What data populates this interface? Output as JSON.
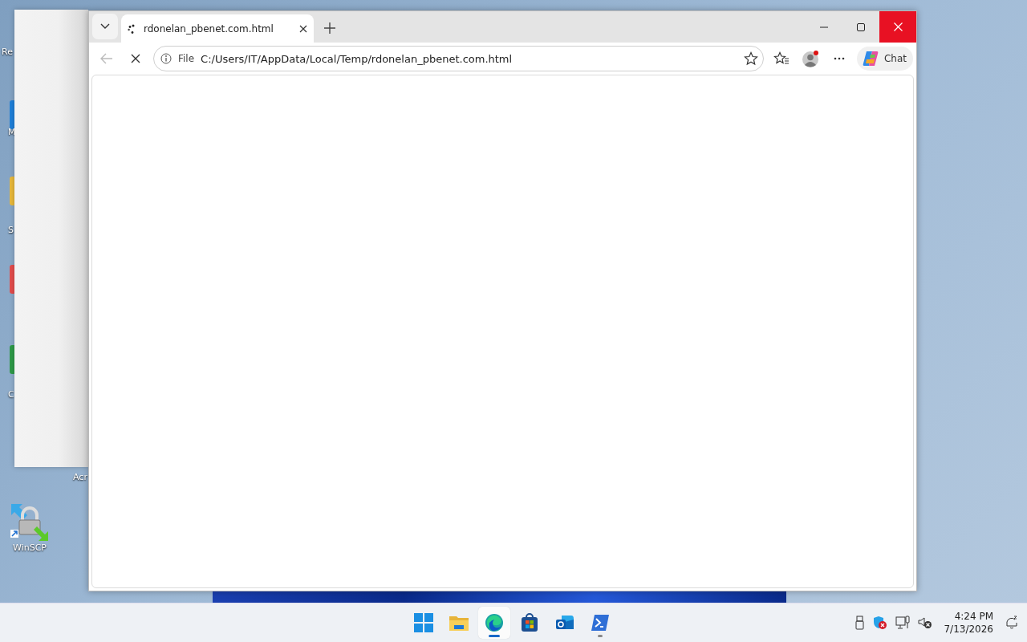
{
  "desktop": {
    "icons": [
      {
        "kind": "label",
        "label": "Re"
      },
      {
        "kind": "blue",
        "label": "M"
      },
      {
        "kind": "yellow",
        "label": "S"
      },
      {
        "kind": "red"
      },
      {
        "kind": "green",
        "label": "C"
      },
      {
        "kind": "label",
        "label": "Acr"
      },
      {
        "kind": "winscp",
        "label": "WinSCP"
      }
    ]
  },
  "browser": {
    "tabs": [
      {
        "title": "rdonelan_pbenet.com.html",
        "selected": true,
        "loading": true
      }
    ],
    "can_go_back": false,
    "loading": true,
    "address": {
      "scheme": "File",
      "url": "C:/Users/IT/AppData/Local/Temp/rdonelan_pbenet.com.html"
    },
    "profile_notification": true,
    "chat_label": "Chat"
  },
  "taskbar": {
    "apps": [
      {
        "kind": "start",
        "selected": false,
        "running": false
      },
      {
        "kind": "explorer",
        "selected": false,
        "running": false
      },
      {
        "kind": "edge",
        "selected": true,
        "running": true
      },
      {
        "kind": "store",
        "selected": false,
        "running": false
      },
      {
        "kind": "outlook",
        "selected": false,
        "running": false
      },
      {
        "kind": "powershell",
        "selected": false,
        "running": true
      }
    ],
    "clock": {
      "time": "4:24 PM",
      "date": "7/13/2026"
    }
  }
}
